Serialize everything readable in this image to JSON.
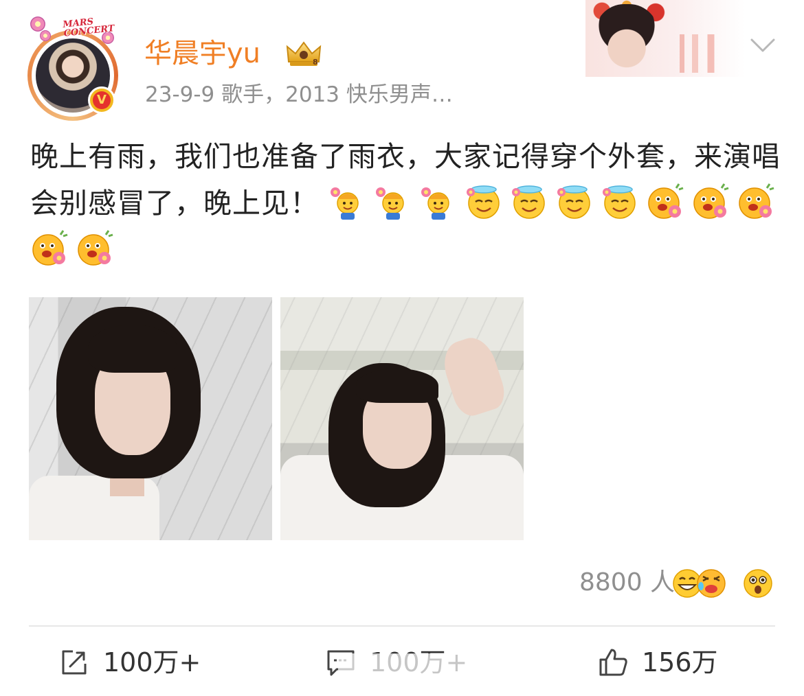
{
  "header": {
    "username": "华晨宇yu",
    "meta": "23-9-9  歌手，2013 快乐男声…",
    "avatar_deco_text_1": "MARS",
    "avatar_deco_text_2": "CONCERT"
  },
  "post": {
    "text": "晚上有雨，我们也准备了雨衣，大家记得穿个外套，来演唱会别感冒了，晚上见！",
    "emojis": [
      "flower-boy-emoji",
      "flower-boy-emoji",
      "flower-boy-emoji",
      "halo-smile-emoji",
      "halo-smile-emoji",
      "halo-smile-emoji",
      "halo-smile-emoji",
      "flower-face-emoji",
      "flower-face-emoji",
      "flower-face-emoji",
      "flower-face-emoji",
      "flower-face-emoji"
    ]
  },
  "reactions": {
    "count": "8800 人",
    "icons": [
      "grin-emoji",
      "laugh-tears-emoji",
      "surprised-emoji"
    ]
  },
  "actions": {
    "share": "100万+",
    "comment": "100万+",
    "like": "156万"
  },
  "colors": {
    "username": "#f07f25",
    "meta": "#8f8f8f",
    "verified": "#f3b81f"
  }
}
